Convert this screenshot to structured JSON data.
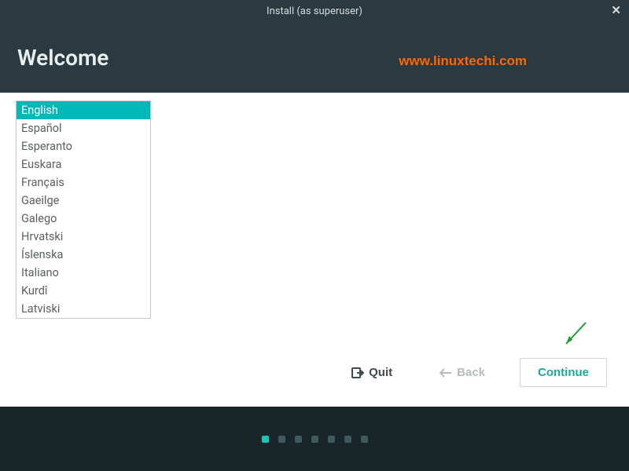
{
  "window": {
    "title": "Install (as superuser)"
  },
  "header": {
    "title": "Welcome",
    "watermark": "www.linuxtechi.com"
  },
  "languages": {
    "selected_index": 0,
    "items": [
      "English",
      "Español",
      "Esperanto",
      "Euskara",
      "Français",
      "Gaeilge",
      "Galego",
      "Hrvatski",
      "Íslenska",
      "Italiano",
      "Kurdî",
      "Latviski"
    ]
  },
  "buttons": {
    "quit": "Quit",
    "back": "Back",
    "continue": "Continue"
  },
  "progress": {
    "total": 7,
    "current": 0
  },
  "colors": {
    "accent": "#00b8b8",
    "header_bg": "#2b3a40",
    "footer_bg": "#18262a",
    "continue_text": "#1aa99a",
    "watermark": "#ff6600"
  }
}
